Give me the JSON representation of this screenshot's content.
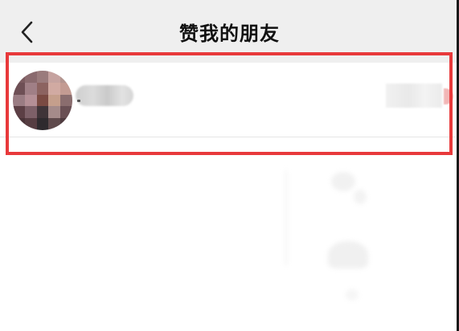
{
  "header": {
    "title": "赞我的朋友",
    "back_icon": "chevron-left-icon"
  },
  "friend_list": {
    "items": [
      {
        "avatar": "avatar-mosaic"
      }
    ]
  },
  "colors": {
    "header_bg": "#efefef",
    "highlight_border": "#e8393b",
    "title_text": "#111111"
  }
}
